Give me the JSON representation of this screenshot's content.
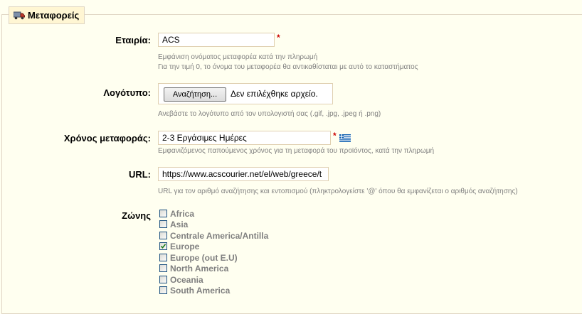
{
  "section": {
    "title": "Μεταφορείς",
    "icon": "truck-icon"
  },
  "company": {
    "label": "Εταιρία:",
    "value": "ACS",
    "required": "*",
    "hint1": "Εμφάνιση ονόματος μεταφορέα κατά την πληρωμή",
    "hint2": "Για την τιμή 0, το όνομα του μεταφορέα θα αντικαθίσταται με αυτό το καταστήματος"
  },
  "logo": {
    "label": "Λογότυπο:",
    "browse_label": "Αναζήτηση...",
    "file_status": "Δεν επιλέχθηκε αρχείο.",
    "hint": "Ανεβάστε το λογότυπο από τον υπολογιστή σας (.gif, .jpg, .jpeg ή .png)"
  },
  "delay": {
    "label": "Χρόνος μεταφοράς:",
    "value": "2-3 Εργάσιμες Ημέρες",
    "required": "*",
    "flag_icon": "greek-flag-icon",
    "hint": "Εμφανιζόμενος παπούμενος χρόνος για τη μεταφορά του προϊόντος, κατά την πληρωμή"
  },
  "url": {
    "label": "URL:",
    "value": "https://www.acscourier.net/el/web/greece/t",
    "hint": "URL για τον αριθμό αναζήτησης και εντοπισμού (πληκτρολογείστε '@' όπου θα εμφανίζεται ο αριθμός αναζήτησης)"
  },
  "zones": {
    "label": "Ζώνης",
    "items": [
      {
        "name": "Africa",
        "checked": false
      },
      {
        "name": "Asia",
        "checked": false
      },
      {
        "name": "Centrale America/Antilla",
        "checked": false
      },
      {
        "name": "Europe",
        "checked": true
      },
      {
        "name": "Europe (out E.U)",
        "checked": false
      },
      {
        "name": "North America",
        "checked": false
      },
      {
        "name": "Oceania",
        "checked": false
      },
      {
        "name": "South America",
        "checked": false
      }
    ]
  }
}
